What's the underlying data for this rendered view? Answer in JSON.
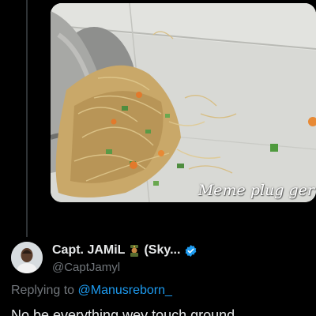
{
  "media": {
    "watermark": "Meme plug ger"
  },
  "reply": {
    "display_name": "Capt. JAMiL",
    "name_emoji": "soldier-emoji",
    "display_name_suffix": "(Sky...",
    "handle": "@CaptJamyl",
    "verified_icon": "verified-badge-icon",
    "replying_to_label": "Replying to",
    "replying_to_mention": "@Manusreborn_",
    "text": "No be everything wey touch ground"
  },
  "colors": {
    "background": "#000000",
    "primary_text": "#e7e9ea",
    "secondary_text": "#71767b",
    "accent": "#1d9bf0"
  }
}
